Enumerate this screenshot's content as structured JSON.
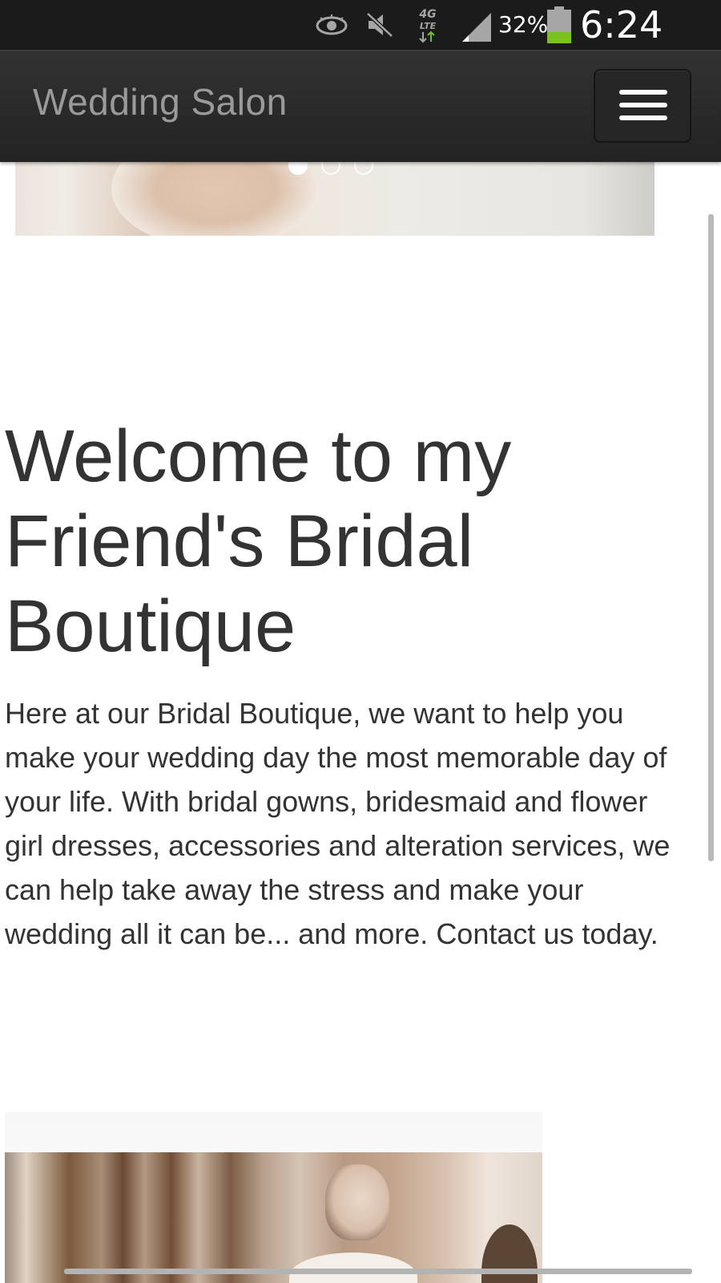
{
  "status_bar": {
    "battery_percent": "32%",
    "time": "6:24 PM",
    "network_label": "4G LTE",
    "icons": [
      "eye-icon",
      "mute-icon",
      "lte-icon",
      "signal-icon",
      "battery-icon"
    ],
    "battery_level": 0.32,
    "battery_color": "#7cc21e"
  },
  "header": {
    "title": "Wedding Salon",
    "menu_icon": "hamburger-menu-icon"
  },
  "carousel": {
    "slide_count": 3,
    "active_slide": 1
  },
  "main": {
    "heading": "Welcome to my Friend's Bridal Boutique",
    "intro": "Here at our Bridal Boutique, we want to help you make your wedding day the most memorable day of your life. With bridal gowns, bridesmaid and flower girl dresses, accessories and alteration services, we can help take away the stress and make your wedding all it can be... and more. Contact us today."
  },
  "colors": {
    "header_bg": "#2b2b2b",
    "title_text": "#9a9a9a",
    "body_text": "#333333"
  }
}
